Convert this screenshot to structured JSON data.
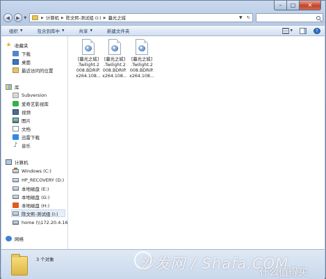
{
  "window": {
    "controls": {
      "minimize": "–",
      "maximize": "□",
      "close": "✕"
    }
  },
  "address": {
    "breadcrumbs": [
      "计算机",
      "陈文熙-测试组 (I:)",
      "暮光之城"
    ],
    "search_placeholder": ""
  },
  "toolbar": {
    "organize": "组织",
    "include_in_library": "包含到库中",
    "share": "共享",
    "new_folder": "新建文件夹",
    "help": "?"
  },
  "sidebar": {
    "favorites": {
      "header": "收藏夹",
      "items": [
        "下载",
        "桌面",
        "最近访问的位置"
      ]
    },
    "libraries": {
      "header": "库",
      "items": [
        "Subversion",
        "爱奇艺影视库",
        "视频",
        "图片",
        "文档",
        "迅雷下载",
        "音乐"
      ]
    },
    "computer": {
      "header": "计算机",
      "items": [
        "Windows  (C:)",
        "HP_RECOVERY (D:)",
        "本地磁盘 (E:)",
        "本地磁盘 (G:)",
        "本地磁盘 (H:)",
        "陈文熙-测试组 (I:)",
        "home (\\\\172.20.4.16"
      ]
    },
    "network": {
      "header": "网络"
    }
  },
  "files": [
    {
      "name_lines": [
        "[暮光之城]",
        ".Twilight.2",
        "008.BDRiP.",
        "x264.108..."
      ],
      "icon": "video-file-icon"
    },
    {
      "name_lines": [
        "[暮光之城]",
        ".Twilight.2",
        "008.BDRiP.",
        "x264.108..."
      ],
      "icon": "video-file-icon"
    },
    {
      "name_lines": [
        "[暮光之城]",
        ".Twilight.2",
        "008.BDRiP.",
        "x264.108..."
      ],
      "icon": "video-file-icon"
    }
  ],
  "status": {
    "count": "3 个对象"
  },
  "watermark": {
    "main": "沙发网 / Shafa.COM",
    "corner": "什么值得买"
  },
  "colors": {
    "accent": "#1e395b",
    "selection": "#e5eef9",
    "folder": "#e7c660"
  }
}
